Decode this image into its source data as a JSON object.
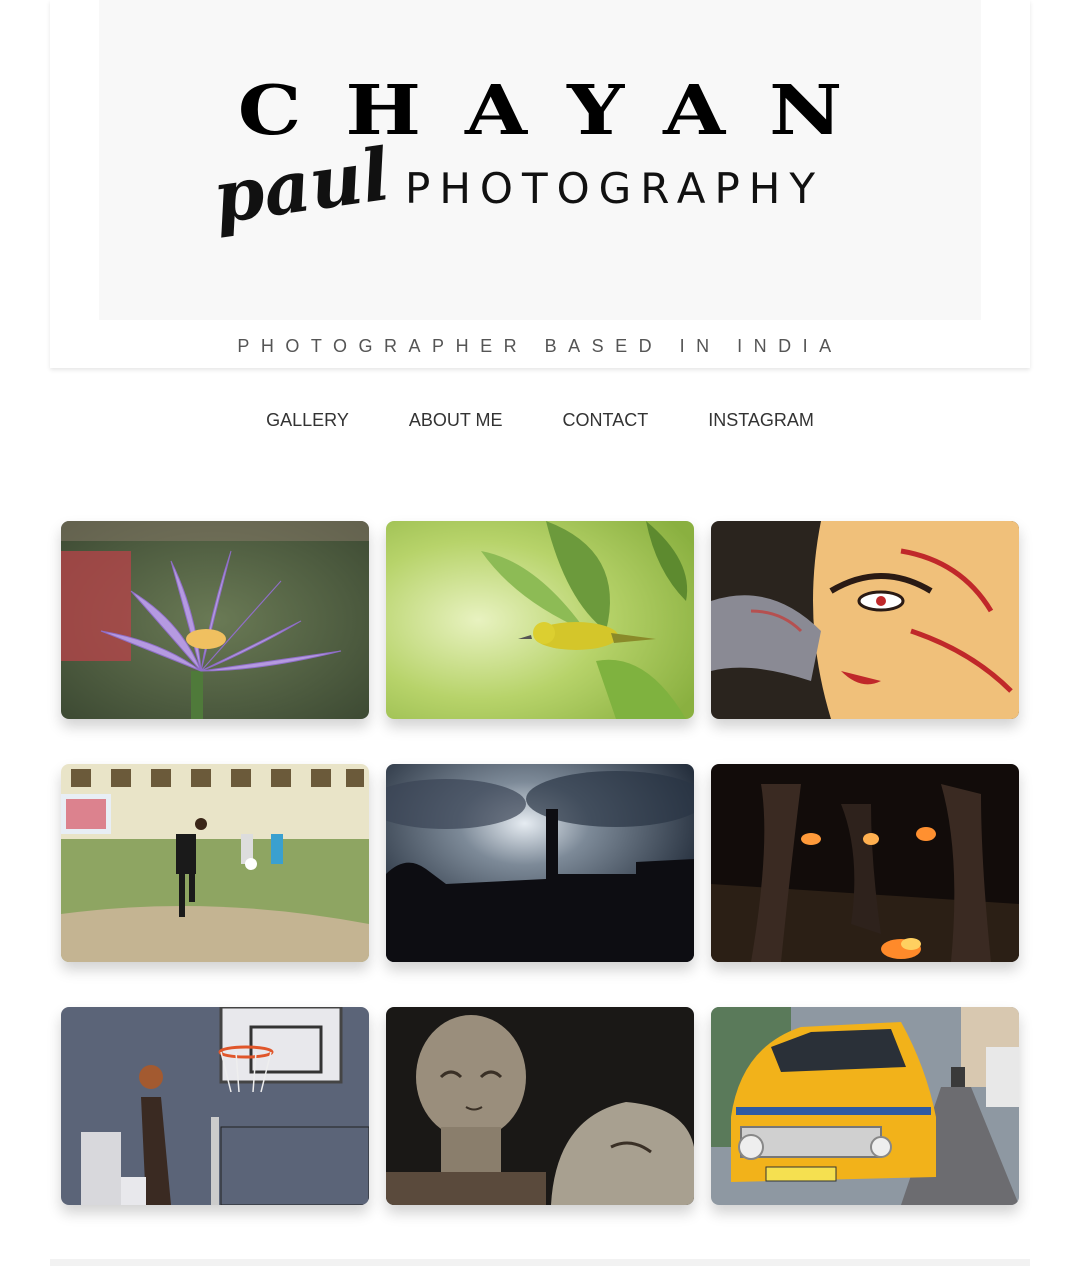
{
  "brand": {
    "name_word": "CHAYAN",
    "name_script": "paul",
    "name_sub": "PHOTOGRAPHY",
    "tagline": "PHOTOGRAPHER BASED IN INDIA"
  },
  "nav": {
    "items": [
      {
        "label": "GALLERY"
      },
      {
        "label": "ABOUT ME"
      },
      {
        "label": "CONTACT"
      },
      {
        "label": "INSTAGRAM"
      }
    ]
  },
  "gallery": {
    "photos": [
      {
        "subject": "purple-lotus-flower"
      },
      {
        "subject": "yellow-bird-on-leaf"
      },
      {
        "subject": "durga-idol-face-painting"
      },
      {
        "subject": "football-players-on-field"
      },
      {
        "subject": "dramatic-sky-silhouette"
      },
      {
        "subject": "fire-dance-at-night"
      },
      {
        "subject": "basketball-players"
      },
      {
        "subject": "clay-sculpture-heads"
      },
      {
        "subject": "yellow-taxi-on-street"
      }
    ]
  },
  "colors": {
    "logo_bg": "#f8f8f8",
    "text_dark": "#333333",
    "tagline": "#555555",
    "taxi_yellow": "#f2b21a",
    "lotus_purple": "#a98ad6"
  }
}
